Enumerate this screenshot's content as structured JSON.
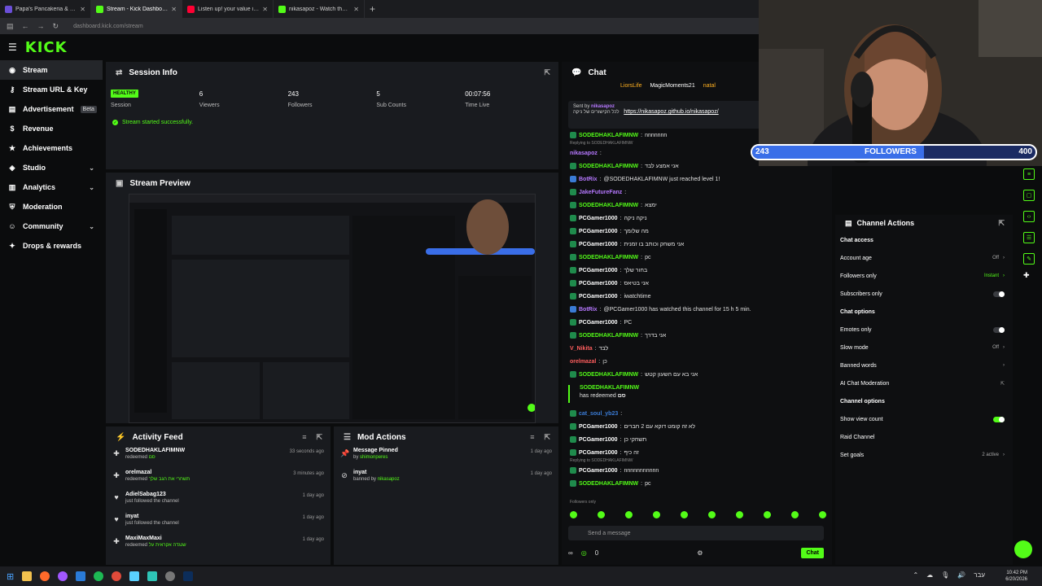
{
  "browser": {
    "tabs": [
      {
        "title": "Papa's Pancakeria & Play",
        "active": false,
        "color": "#6b4fd8"
      },
      {
        "title": "Stream - Kick Dashboard",
        "active": true,
        "color": "#53fc18"
      },
      {
        "title": "Listen up! your value isn't d",
        "active": false,
        "color": "#ff0033"
      },
      {
        "title": "nikasapoz - Watch the VOD",
        "active": false,
        "color": "#53fc18"
      }
    ],
    "new_tab": "+",
    "url": "dashboard.kick.com/stream"
  },
  "logo": "KICK",
  "sidebar": {
    "items": [
      {
        "label": "Stream",
        "icon": "stream-icon",
        "active": true,
        "chevron": false
      },
      {
        "label": "Stream URL & Key",
        "icon": "key-icon",
        "active": false,
        "chevron": false
      },
      {
        "label": "Advertisement",
        "icon": "advertisement-icon",
        "active": false,
        "chevron": false,
        "badge": "Beta"
      },
      {
        "label": "Revenue",
        "icon": "revenue-icon",
        "active": false,
        "chevron": false
      },
      {
        "label": "Achievements",
        "icon": "achievements-icon",
        "active": false,
        "chevron": false
      },
      {
        "label": "Studio",
        "icon": "studio-icon",
        "active": false,
        "chevron": true
      },
      {
        "label": "Analytics",
        "icon": "analytics-icon",
        "active": false,
        "chevron": true
      },
      {
        "label": "Moderation",
        "icon": "moderation-icon",
        "active": false,
        "chevron": false
      },
      {
        "label": "Community",
        "icon": "community-icon",
        "active": false,
        "chevron": true
      },
      {
        "label": "Drops & rewards",
        "icon": "drops-icon",
        "active": false,
        "chevron": false
      }
    ]
  },
  "session": {
    "title": "Session Info",
    "status": "HEALTHY",
    "stats": [
      {
        "value": "6",
        "label": "Viewers"
      },
      {
        "value": "243",
        "label": "Followers"
      },
      {
        "value": "5",
        "label": "Sub Counts"
      },
      {
        "value": "00:07:56",
        "label": "Time Live"
      }
    ],
    "session_label": "Session",
    "message": "Stream started successfully."
  },
  "preview": {
    "title": "Stream Preview"
  },
  "activity": {
    "title": "Activity Feed",
    "items": [
      {
        "name": "SODEDHAKLAFIMNW",
        "action": "redeemed",
        "extra": "סם",
        "time": "33 seconds ago",
        "icon": "reward-icon"
      },
      {
        "name": "orelmazal",
        "action": "redeemed",
        "extra": "תשחרי את הגב שלך",
        "time": "3 minutes ago",
        "icon": "reward-icon"
      },
      {
        "name": "AdielSabag123",
        "action": "just followed the channel",
        "extra": "",
        "time": "1 day ago",
        "icon": "heart-icon"
      },
      {
        "name": "inyat",
        "action": "just followed the channel",
        "extra": "",
        "time": "1 day ago",
        "icon": "heart-icon"
      },
      {
        "name": "MaxiMaxMaxi",
        "action": "redeemed",
        "extra": "שנגדה אקראית על",
        "time": "1 day ago",
        "icon": "reward-icon"
      }
    ]
  },
  "mod": {
    "title": "Mod Actions",
    "items": [
      {
        "name": "Message Pinned",
        "action": "by",
        "extra": "shimonperes",
        "time": "1 day ago",
        "icon": "pin-icon"
      },
      {
        "name": "inyat",
        "action": "banned by",
        "extra": "nikasapoz",
        "time": "1 day ago",
        "icon": "ban-icon"
      }
    ]
  },
  "chat": {
    "title": "Chat",
    "top_chatters": [
      {
        "name": "LiorsLife",
        "color": "#ffb020"
      },
      {
        "name": "MagicMoments21",
        "color": "#ffffff"
      },
      {
        "name": "natal",
        "color": "#ffb020"
      }
    ],
    "pinned": {
      "sent_by_label": "Sent by",
      "sent_by": "nikasapoz",
      "text": "לכל הקישורים של ניקה",
      "link": "https://nikasapoz.github.io/nikasapoz/"
    },
    "messages": [
      {
        "user": "SODEDHAKLAFIMNW",
        "color": "#53fc18",
        "text": "nnnnnnn",
        "badge": "g"
      },
      {
        "user": "nikasapoz",
        "color": "#b678ff",
        "text": "",
        "badge": ""
      },
      {
        "user": "SODEDHAKLAFIMNW",
        "color": "#53fc18",
        "text": "אני אמצע לבד",
        "badge": "g"
      },
      {
        "user": "BotRix",
        "color": "#b678ff",
        "text": "@SODEDHAKLAFIMNW just reached level 1!",
        "badge": "b"
      },
      {
        "user": "JakeFutureFanz",
        "color": "#b678ff",
        "text": "",
        "badge": "g"
      },
      {
        "user": "SODEDHAKLAFIMNW",
        "color": "#53fc18",
        "text": "ימצא",
        "badge": "g"
      },
      {
        "user": "PCGamer1000",
        "color": "#ffffff",
        "text": "ניקה ניקה",
        "badge": "g"
      },
      {
        "user": "PCGamer1000",
        "color": "#ffffff",
        "text": "מה שלומך",
        "badge": "g"
      },
      {
        "user": "PCGamer1000",
        "color": "#ffffff",
        "text": "אני משחק וכותב בו זמנית",
        "badge": "g"
      },
      {
        "user": "SODEDHAKLAFIMNW",
        "color": "#53fc18",
        "text": "pc",
        "badge": "g"
      },
      {
        "user": "PCGamer1000",
        "color": "#ffffff",
        "text": "בחור שלך",
        "badge": "g"
      },
      {
        "user": "PCGamer1000",
        "color": "#ffffff",
        "text": "אני בטיאס",
        "badge": "g"
      },
      {
        "user": "PCGamer1000",
        "color": "#ffffff",
        "text": "iwatchtime",
        "badge": "g"
      },
      {
        "user": "BotRix",
        "color": "#b678ff",
        "text": "@PCGamer1000 has watched this channel for 15 h 5 min.",
        "badge": "b"
      },
      {
        "user": "PCGamer1000",
        "color": "#ffffff",
        "text": "PC",
        "badge": "g"
      },
      {
        "user": "SODEDHAKLAFIMNW",
        "color": "#53fc18",
        "text": "אני בדרך",
        "badge": "g"
      },
      {
        "user": "V_Nikita",
        "color": "#ff5e5e",
        "text": "לבד",
        "badge": ""
      },
      {
        "user": "orelmazal",
        "color": "#ff5e5e",
        "text": "כן",
        "badge": ""
      },
      {
        "user": "SODEDHAKLAFIMNW",
        "color": "#53fc18",
        "text": "אני בא עם השעון קטש",
        "badge": "g"
      }
    ],
    "redeem": {
      "user": "SODEDHAKLAFIMNW",
      "text": "has redeemed",
      "reward": "סם"
    },
    "messages2": [
      {
        "user": "cat_soul_yb23",
        "color": "#3a7bd5",
        "text": "",
        "badge": "g"
      },
      {
        "user": "PCGamer1000",
        "color": "#ffffff",
        "text": "לא זה קומט דוקא עם 2 חברים",
        "badge": "g"
      },
      {
        "user": "PCGamer1000",
        "color": "#ffffff",
        "text": "תשחקי כן",
        "badge": "g"
      },
      {
        "user": "PCGamer1000",
        "color": "#ffffff",
        "text": "זה כיף",
        "badge": "g"
      },
      {
        "user": "PCGamer1000",
        "color": "#ffffff",
        "text": "nnnnnnnnnnn",
        "badge": "g"
      },
      {
        "user": "SODEDHAKLAFIMNW",
        "color": "#53fc18",
        "text": "pc",
        "badge": "g"
      }
    ],
    "reply_label_1": "Replying to SODEDHAKLAFIMNW",
    "reply_label_2": "Replying to SODEDHAKLAFIMNW",
    "followers_only": "Followers only",
    "placeholder": "Send a message",
    "count": "0",
    "send": "Chat"
  },
  "channel_actions": {
    "title": "Channel Actions",
    "sections": [
      {
        "title": "Chat access",
        "rows": [
          {
            "label": "Account age",
            "value": "Off",
            "kind": "chevron"
          },
          {
            "label": "Followers only",
            "value": "Instant",
            "kind": "chevron-green"
          },
          {
            "label": "Subscribers only",
            "value": "",
            "kind": "toggle-off"
          }
        ]
      },
      {
        "title": "Chat options",
        "rows": [
          {
            "label": "Emotes only",
            "value": "",
            "kind": "toggle-off"
          },
          {
            "label": "Slow mode",
            "value": "Off",
            "kind": "chevron"
          },
          {
            "label": "Banned words",
            "value": "",
            "kind": "chevron"
          },
          {
            "label": "AI Chat Moderation",
            "value": "",
            "kind": "external"
          }
        ]
      },
      {
        "title": "Channel options",
        "rows": [
          {
            "label": "Show view count",
            "value": "",
            "kind": "toggle-on"
          },
          {
            "label": "Raid Channel",
            "value": "",
            "kind": "none"
          },
          {
            "label": "Set goals",
            "value": "2 active",
            "kind": "chevron"
          }
        ]
      }
    ]
  },
  "overlay": {
    "followers": 243,
    "label": "FOLLOWERS",
    "goal": 400,
    "progress": 0.6075
  },
  "taskbar": {
    "time": "10:42 PM",
    "date": "6/20/2026",
    "lang": "עבר"
  },
  "colors": {
    "accent": "#53fc18",
    "panel": "#191b1f",
    "bg": "#0b0c0d"
  }
}
